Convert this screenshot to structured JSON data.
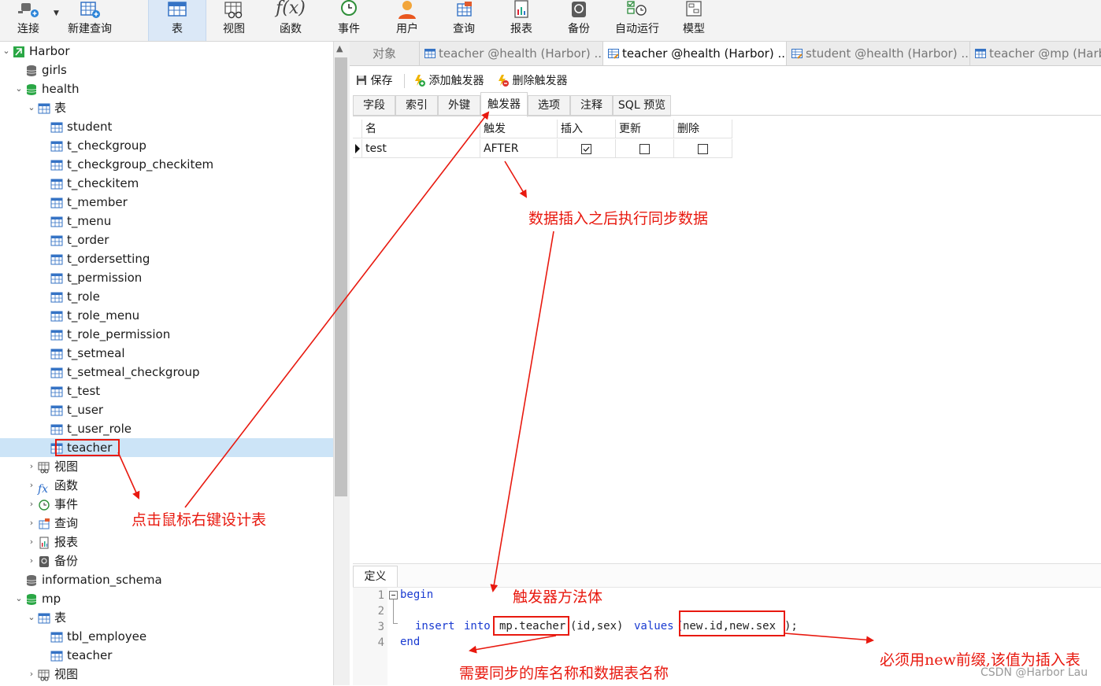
{
  "toolbar": {
    "items": [
      {
        "label": "连接",
        "icon": "connect-plug-icon"
      },
      {
        "label": "新建查询",
        "icon": "new-query-icon"
      },
      {
        "label": "表",
        "icon": "table-icon",
        "active": true
      },
      {
        "label": "视图",
        "icon": "view-icon"
      },
      {
        "label": "函数",
        "icon": "function-icon"
      },
      {
        "label": "事件",
        "icon": "event-clock-icon"
      },
      {
        "label": "用户",
        "icon": "user-icon"
      },
      {
        "label": "查询",
        "icon": "query-icon"
      },
      {
        "label": "报表",
        "icon": "report-icon"
      },
      {
        "label": "备份",
        "icon": "backup-icon"
      },
      {
        "label": "自动运行",
        "icon": "autorun-icon"
      },
      {
        "label": "模型",
        "icon": "model-icon"
      }
    ]
  },
  "tree": {
    "connection": "Harbor",
    "db_girls": "girls",
    "db_health": "health",
    "tables_folder": "表",
    "health_tables": [
      "student",
      "t_checkgroup",
      "t_checkgroup_checkitem",
      "t_checkitem",
      "t_member",
      "t_menu",
      "t_order",
      "t_ordersetting",
      "t_permission",
      "t_role",
      "t_role_menu",
      "t_role_permission",
      "t_setmeal",
      "t_setmeal_checkgroup",
      "t_test",
      "t_user",
      "t_user_role",
      "teacher"
    ],
    "health_folders": [
      "视图",
      "函数",
      "事件",
      "查询",
      "报表",
      "备份"
    ],
    "db_info": "information_schema",
    "db_mp": "mp",
    "mp_tables_folder": "表",
    "mp_tables": [
      "tbl_employee",
      "teacher"
    ],
    "mp_views": "视图"
  },
  "tabs": [
    {
      "label": "对象"
    },
    {
      "label": "teacher @health (Harbor) ..."
    },
    {
      "label": "teacher @health (Harbor) ...",
      "active": true
    },
    {
      "label": "student @health (Harbor) ..."
    },
    {
      "label": "teacher @mp (Harb"
    }
  ],
  "subtoolbar": {
    "save": "保存",
    "add_trigger": "添加触发器",
    "delete_trigger": "删除触发器"
  },
  "design_tabs": [
    "字段",
    "索引",
    "外键",
    "触发器",
    "选项",
    "注释",
    "SQL 预览"
  ],
  "grid": {
    "headers": [
      "名",
      "触发",
      "插入",
      "更新",
      "删除"
    ],
    "rows": [
      {
        "name": "test",
        "fire": "AFTER",
        "insert": true,
        "update": false,
        "delete": false
      }
    ]
  },
  "definition_tab": "定义",
  "code": {
    "line_numbers": [
      "1",
      "2",
      "3",
      "4"
    ],
    "l1_kw": "begin",
    "l3_kw1": "insert",
    "l3_kw2": "into",
    "l3_table": "mp.teacher",
    "l3_cols": "(id,sex)",
    "l3_kw3": "values",
    "l3_open": "(",
    "l3_vals": "new.id,new.sex",
    "l3_close": ");",
    "l4_kw": "end"
  },
  "annotations": {
    "a1": "数据插入之后执行同步数据",
    "a2": "点击鼠标右键设计表",
    "a3": "触发器方法体",
    "a4": "需要同步的库名称和数据表名称",
    "a5": "必须用new前缀,该值为插入表"
  },
  "watermark": "CSDN @Harbor Lau",
  "colors": {
    "annotation": "#e8190f",
    "selection": "#cce4f7",
    "keyword": "#1a3bd1",
    "db_green": "#2aa745"
  }
}
